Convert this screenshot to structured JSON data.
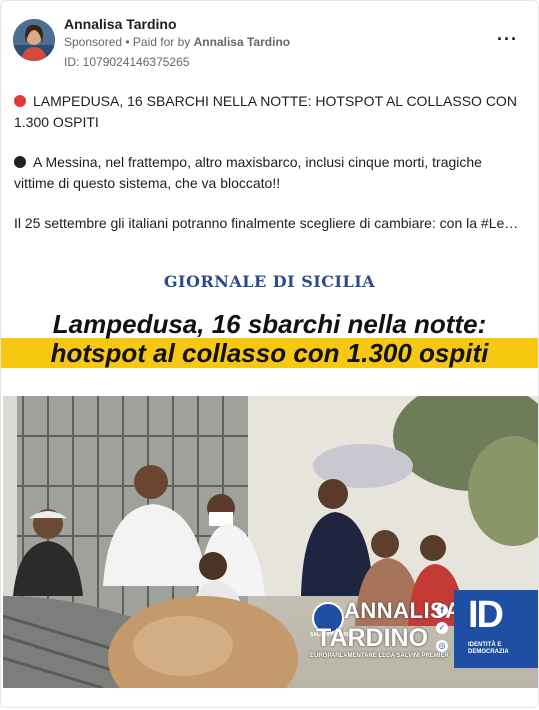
{
  "post": {
    "author": "Annalisa Tardino",
    "sponsored": "Sponsored",
    "paid_for_by_prefix": "• Paid for by",
    "paid_for_by_name": "Annalisa Tardino",
    "ad_id": "ID: 1079024146375265",
    "more_label": "···"
  },
  "body": {
    "para1": "LAMPEDUSA, 16 SBARCHI NELLA NOTTE: HOTSPOT AL COLLASSO CON 1.300 OSPITI",
    "para2": "A Messina, nel frattempo, altro maxisbarco, inclusi cinque morti, tragiche vittime di questo sistema, che va bloccato!!",
    "para3": "Il 25 settembre gli italiani potranno finalmente scegliere di cambiare: con la #Leg…"
  },
  "creative": {
    "masthead": "GIORNALE DI SICILIA",
    "headline_line1": "Lampedusa, 16 sbarchi nella notte:",
    "headline_line2": "hotspot al collasso con 1.300 ospiti",
    "badge_name_first": "ANNALISA",
    "badge_name_last": "TARDINO",
    "badge_role": "EUROPARLAMENTARE LEGA SALVINI PREMIER",
    "badge_party_small": "SALVINI PREMIER",
    "badge_group": "IDENTITÀ E DEMOCRAZIA",
    "badge_logo": "ID"
  },
  "colors": {
    "accent_yellow": "#f7c811",
    "masthead_blue": "#2c4a86",
    "badge_blue": "#1f4fa3",
    "text_secondary": "#65676b"
  },
  "icons": [
    "red-circle-icon",
    "black-circle-icon",
    "facebook-icon",
    "twitter-icon",
    "instagram-icon",
    "more-options-icon"
  ]
}
